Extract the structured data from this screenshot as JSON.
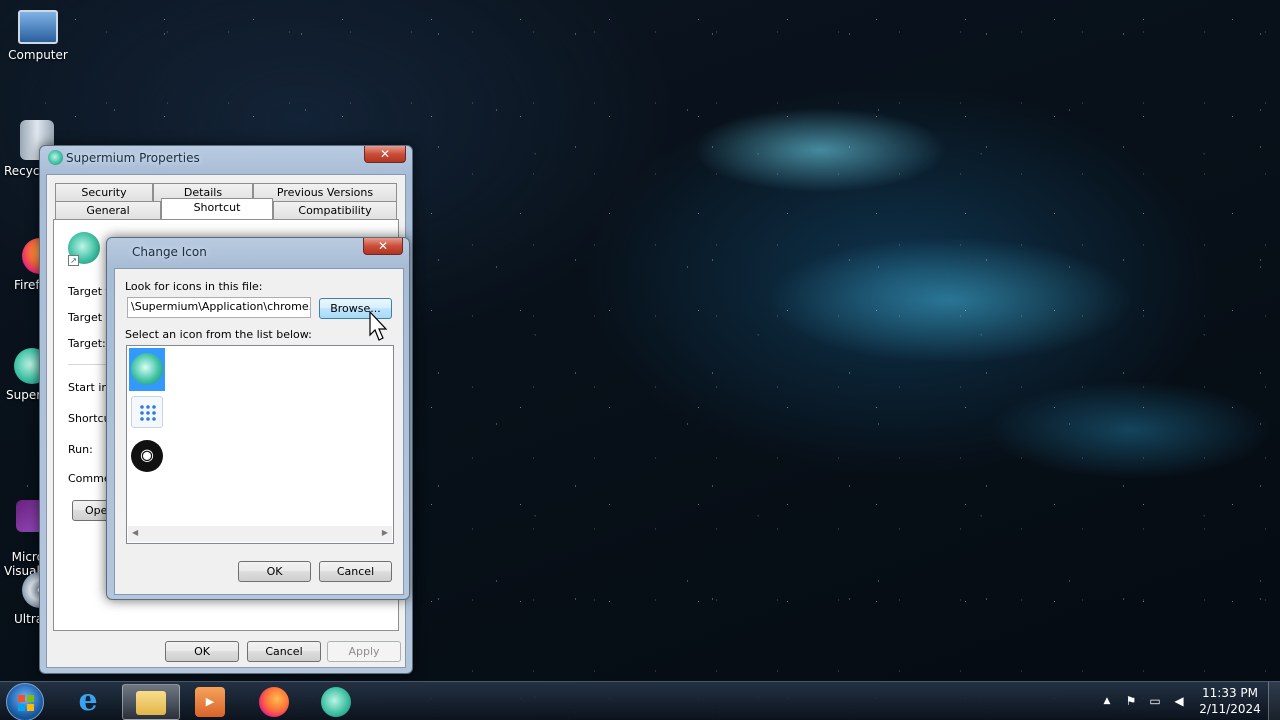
{
  "desktop": {
    "icons": [
      {
        "label": "Computer"
      },
      {
        "label": "Recycl"
      },
      {
        "label": "Firef"
      },
      {
        "label": "Superm"
      },
      {
        "label": "Micros\nVisual S"
      },
      {
        "label": "Ultra"
      }
    ]
  },
  "properties_window": {
    "title": "Supermium Properties",
    "close": "✕",
    "tabs_row1": [
      "Security",
      "Details",
      "Previous Versions"
    ],
    "tabs_row2": [
      "General",
      "Shortcut",
      "Compatibility"
    ],
    "labels": [
      "Target typ",
      "Target lo",
      "Target:",
      "Start in:",
      "Shortcut k",
      "Run:",
      "Comment"
    ],
    "open_button": "Open",
    "ok": "OK",
    "cancel": "Cancel",
    "apply": "Apply"
  },
  "change_icon_dialog": {
    "title": "Change Icon",
    "close": "✕",
    "look_label": "Look for icons in this file:",
    "file_value": "\\Supermium\\Application\\chrome.exe",
    "browse": "Browse...",
    "select_label": "Select an icon from the list below:",
    "icons": [
      "supermium-icon",
      "app-grid-icon",
      "incognito-icon"
    ],
    "ok": "OK",
    "cancel": "Cancel"
  },
  "taskbar": {
    "apps": [
      "start-orb",
      "internet-explorer",
      "file-explorer",
      "media-player",
      "firefox",
      "supermium"
    ],
    "time": "11:33 PM",
    "date": "2/11/2024"
  },
  "colors": {
    "accent": "#3c7fb1",
    "selection": "#3399ff",
    "supermium_teal": "#2a9d8f"
  }
}
